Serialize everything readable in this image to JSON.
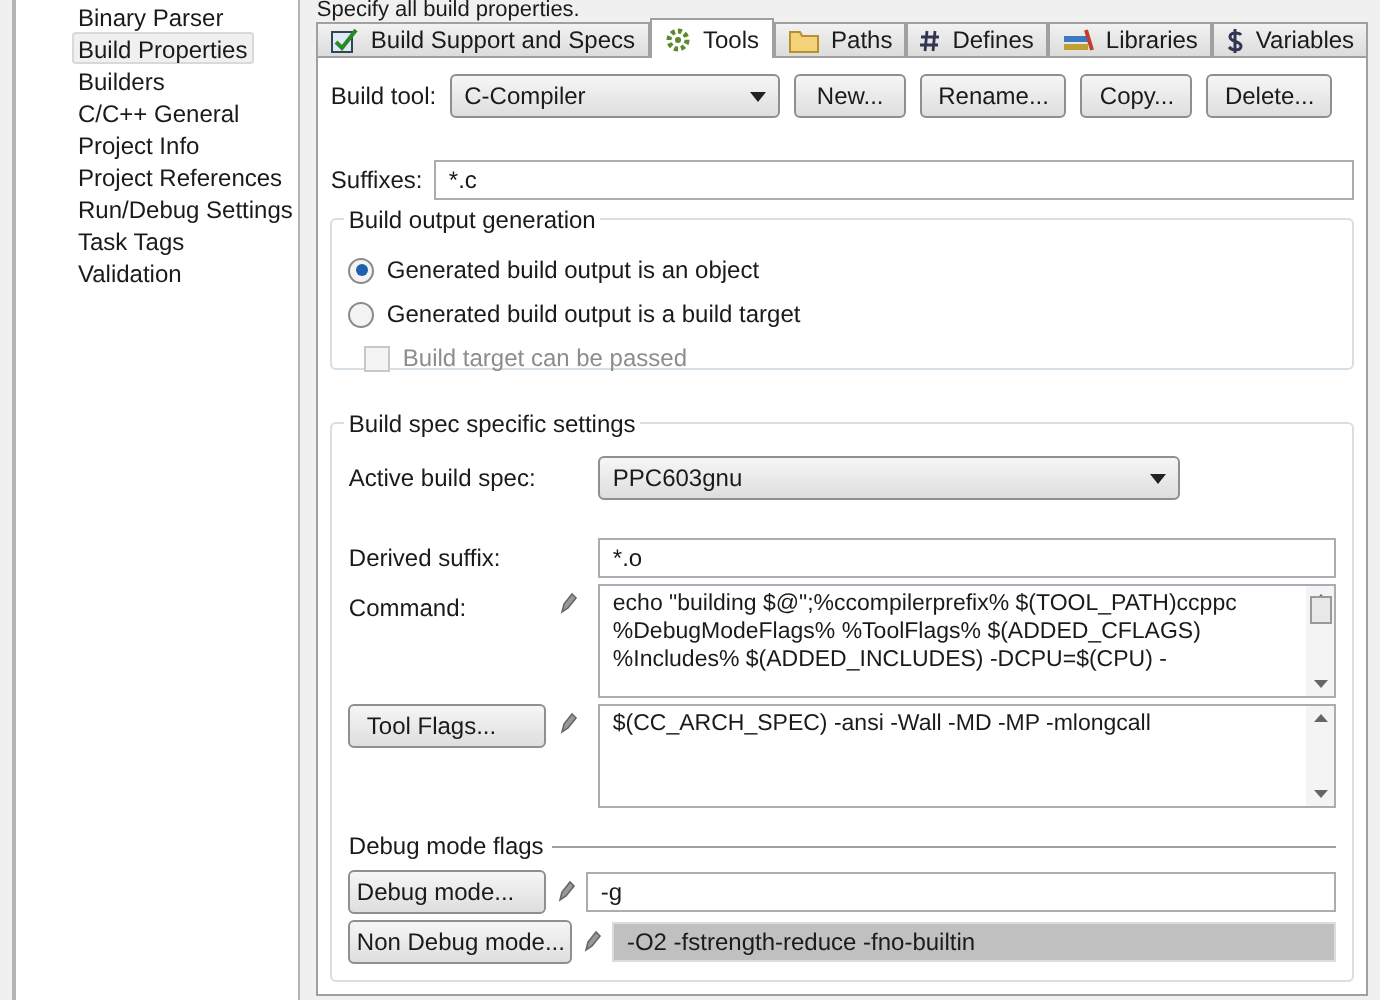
{
  "sidebar": {
    "items": [
      {
        "label": "Binary Parser",
        "selected": false
      },
      {
        "label": "Build Properties",
        "selected": true
      },
      {
        "label": "Builders",
        "selected": false
      },
      {
        "label": "C/C++ General",
        "selected": false
      },
      {
        "label": "Project Info",
        "selected": false
      },
      {
        "label": "Project References",
        "selected": false
      },
      {
        "label": "Run/Debug Settings",
        "selected": false
      },
      {
        "label": "Task Tags",
        "selected": false
      },
      {
        "label": "Validation",
        "selected": false
      }
    ]
  },
  "heading": "Specify all build properties.",
  "tabs": [
    {
      "label": "Build Support and Specs",
      "selected": false
    },
    {
      "label": "Tools",
      "selected": true
    },
    {
      "label": "Paths",
      "selected": false
    },
    {
      "label": "Defines",
      "selected": false
    },
    {
      "label": "Libraries",
      "selected": false
    },
    {
      "label": "Variables",
      "selected": false
    }
  ],
  "build_tool": {
    "label": "Build tool:",
    "value": "C-Compiler",
    "buttons": [
      "New...",
      "Rename...",
      "Copy...",
      "Delete..."
    ]
  },
  "suffixes": {
    "label": "Suffixes:",
    "value": "*.c"
  },
  "output_group": {
    "title": "Build output generation",
    "options": [
      {
        "label": "Generated build output is an object",
        "kind": "radio",
        "selected": true,
        "disabled": false
      },
      {
        "label": "Generated build output is a build target",
        "kind": "radio",
        "selected": false,
        "disabled": false
      },
      {
        "label": "Build target can be passed",
        "kind": "checkbox",
        "checked": false,
        "disabled": true
      }
    ]
  },
  "spec_group": {
    "title": "Build spec specific settings",
    "active_spec": {
      "label": "Active build spec:",
      "value": "PPC603gnu"
    },
    "derived_suffix": {
      "label": "Derived suffix:",
      "value": "*.o"
    },
    "command": {
      "label": "Command:",
      "value": "echo \"building $@\";%ccompilerprefix% $(TOOL_PATH)ccppc %DebugModeFlags% %ToolFlags% $(ADDED_CFLAGS) %Includes% $(ADDED_INCLUDES) -DCPU=$(CPU) -"
    },
    "tool_flags": {
      "button": "Tool Flags...",
      "value": "$(CC_ARCH_SPEC) -ansi  -Wall  -MD -MP -mlongcall"
    },
    "debug_title": "Debug mode flags",
    "debug_mode": {
      "button": "Debug mode...",
      "value": "-g",
      "selected": false
    },
    "non_debug_mode": {
      "button": "Non Debug mode...",
      "value": "-O2 -fstrength-reduce -fno-builtin",
      "selected": true
    }
  }
}
